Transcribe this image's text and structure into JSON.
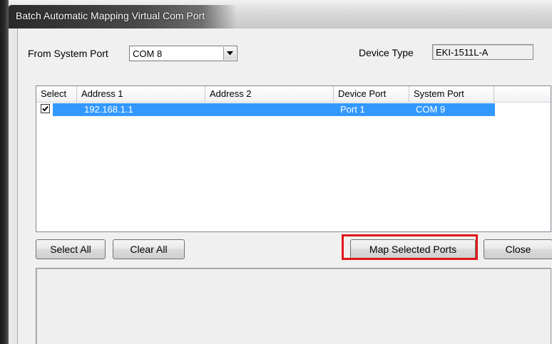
{
  "window": {
    "title": "Batch Automatic Mapping Virtual Com Port"
  },
  "form": {
    "from_system_port_label": "From System Port",
    "from_system_port_value": "COM 8",
    "device_type_label": "Device Type",
    "device_type_value": "EKI-1511L-A"
  },
  "table": {
    "columns": [
      "Select",
      "Address 1",
      "Address 2",
      "Device Port",
      "System Port"
    ],
    "rows": [
      {
        "checked": true,
        "address1": "192.168.1.1",
        "address2": "",
        "device_port": "Port 1",
        "system_port": "COM 9"
      }
    ]
  },
  "buttons": {
    "select_all": "Select All",
    "clear_all": "Clear All",
    "map_selected": "Map Selected Ports",
    "close": "Close"
  },
  "colors": {
    "selection": "#3399ff",
    "highlight_box": "#e0161b"
  },
  "icons": {
    "dropdown": "chevron-down-icon",
    "checkbox": "checkmark-icon"
  }
}
